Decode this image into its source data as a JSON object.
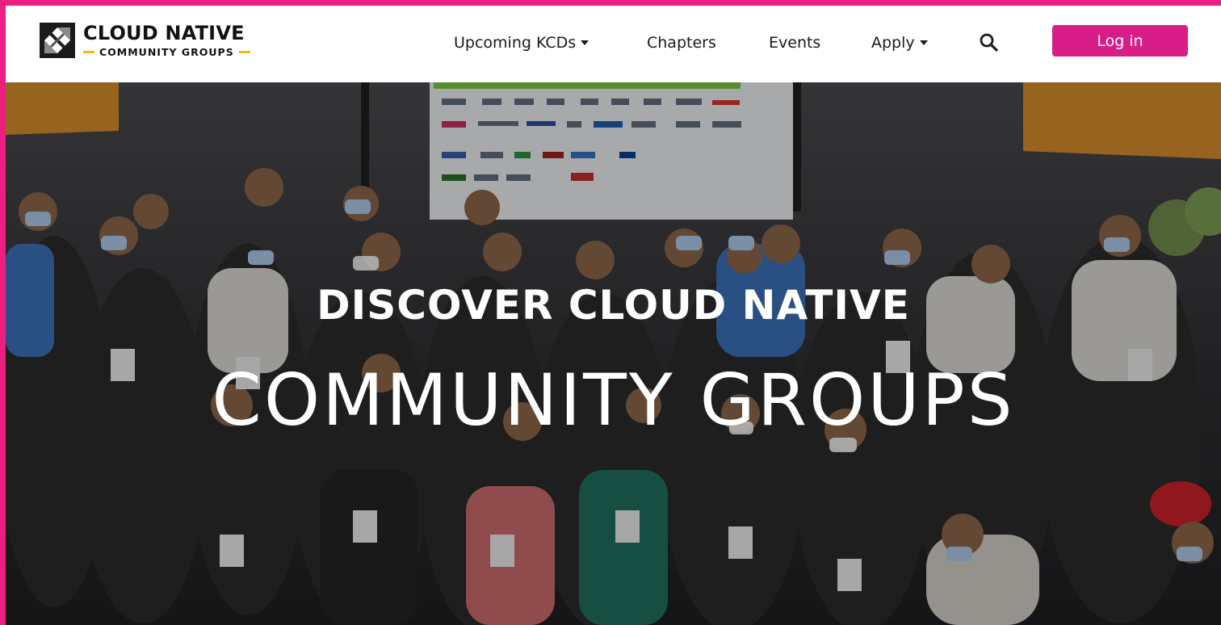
{
  "brand": {
    "name_line1": "CLOUD NATIVE",
    "name_line2": "COMMUNITY GROUPS",
    "accent_color": "#f6b70f",
    "logo_icon": "cncf-logo-icon"
  },
  "nav": {
    "items": [
      {
        "label": "Upcoming KCDs",
        "has_dropdown": true
      },
      {
        "label": "Chapters",
        "has_dropdown": false
      },
      {
        "label": "Events",
        "has_dropdown": false
      },
      {
        "label": "Apply",
        "has_dropdown": true
      }
    ],
    "search_icon": "search-icon",
    "login_label": "Log in",
    "login_color": "#d81e86"
  },
  "hero": {
    "headline": "DISCOVER CLOUD NATIVE",
    "subheadline": "COMMUNITY GROUPS",
    "background": "group-photo"
  },
  "theme": {
    "frame_color": "#ec1f80"
  }
}
